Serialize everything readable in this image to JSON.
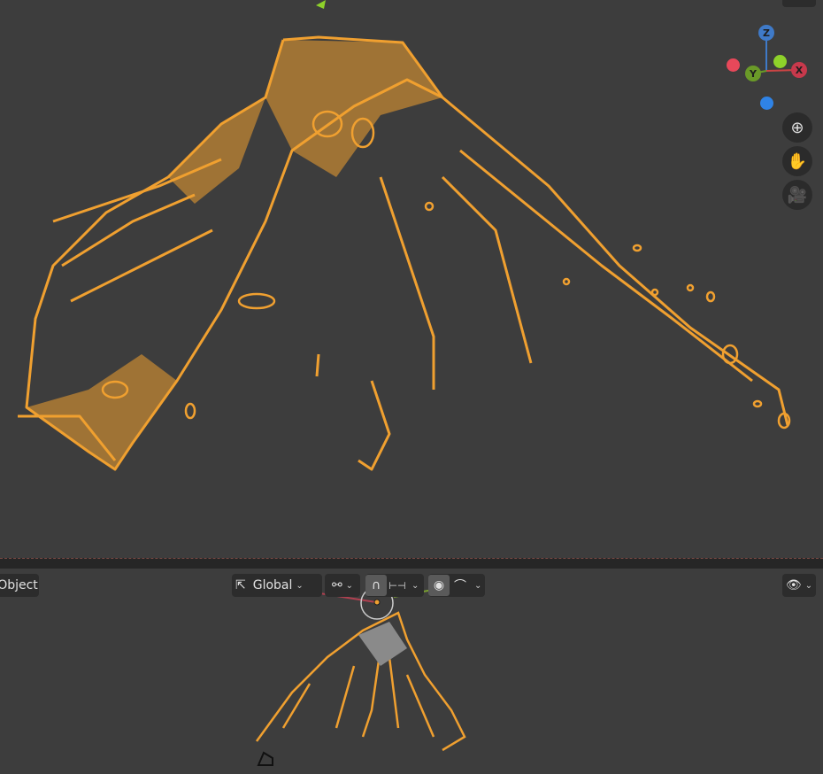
{
  "header": {
    "mode_label": "Object",
    "transform_orientation": "Global"
  },
  "gizmo": {
    "axes": {
      "x": "X",
      "y": "Y",
      "z": "Z"
    },
    "colors": {
      "x": "#e8485a",
      "y": "#7bb92c",
      "z": "#3f7ac8",
      "neg_x": "#e8485a",
      "neg_y": "#8ed12a",
      "neg_z": "#2f83e6"
    }
  },
  "nav_buttons": [
    "zoom-icon",
    "pan-hand-icon",
    "camera-icon"
  ],
  "colors": {
    "selection": "#f0a030",
    "background": "#3d3d3d"
  }
}
